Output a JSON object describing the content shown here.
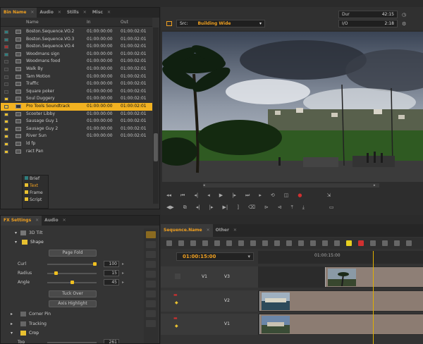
{
  "bin_panel": {
    "tabs": [
      {
        "label": "Bin Name",
        "active": true
      },
      {
        "label": "Audio",
        "active": false
      },
      {
        "label": "Stills",
        "active": false
      },
      {
        "label": "Misc",
        "active": false
      }
    ],
    "columns": [
      "Name",
      "In",
      "Out"
    ],
    "rows": [
      {
        "name": "Boston.Sequence.VO.2",
        "in": "01:00:00:00",
        "out": "01:00:02:01",
        "color": "#2e7e7e",
        "selected": false
      },
      {
        "name": "Boston.Sequence.VO.3",
        "in": "01:00:00:00",
        "out": "01:00:02:01",
        "color": "#2e7e7e",
        "selected": false
      },
      {
        "name": "Boston.Sequence.VO.4",
        "in": "01:00:00:00",
        "out": "01:00:02:01",
        "color": "#a83030",
        "selected": false
      },
      {
        "name": "Woodmans sign",
        "in": "01:00:00:00",
        "out": "01:00:02:01",
        "color": "#2e7e7e",
        "selected": false
      },
      {
        "name": "Woodmans food",
        "in": "01:00:00:00",
        "out": "01:00:02:01",
        "color": "",
        "selected": false
      },
      {
        "name": "Walk By",
        "in": "01:00:00:00",
        "out": "01:00:02:01",
        "color": "",
        "selected": false
      },
      {
        "name": "Tam Motion",
        "in": "01:00:00:00",
        "out": "01:00:02:01",
        "color": "",
        "selected": false
      },
      {
        "name": "Traffic",
        "in": "01:00:00:00",
        "out": "01:00:02:01",
        "color": "",
        "selected": false
      },
      {
        "name": "Square poker",
        "in": "01:00:00:00",
        "out": "01:00:02:01",
        "color": "",
        "selected": false
      },
      {
        "name": "Soul Duggery",
        "in": "01:00:00:00",
        "out": "01:00:02:01",
        "color": "#e8c030",
        "selected": false
      },
      {
        "name": "Pro Tools Soundtrack",
        "in": "01:00:00:00",
        "out": "01:00:02:01",
        "color": "#e8c030",
        "selected": true
      },
      {
        "name": "Scooter Libby",
        "in": "01:00:00:00",
        "out": "01:00:02:01",
        "color": "#e8c030",
        "selected": false
      },
      {
        "name": "Sausage Guy 1",
        "in": "01:00:00:00",
        "out": "01:00:02:01",
        "color": "#e8c030",
        "selected": false
      },
      {
        "name": "Sausage Guy 2",
        "in": "01:00:00:00",
        "out": "01:00:02:01",
        "color": "#e8c030",
        "selected": false
      },
      {
        "name": "River Sun",
        "in": "01:00:00:00",
        "out": "01:00:02:01",
        "color": "#e8c030",
        "selected": false
      },
      {
        "name": "ld fp",
        "in": "",
        "out": "",
        "color": "#e8c030",
        "selected": false
      },
      {
        "name": "ract Pan",
        "in": "",
        "out": "",
        "color": "#e8c030",
        "selected": false
      }
    ],
    "overlay_items": [
      {
        "label": "Brief",
        "color": "#2e7e7e"
      },
      {
        "label": "Text",
        "color": "#e8c030"
      },
      {
        "label": "Frame",
        "color": "#e8c030"
      },
      {
        "label": "Script",
        "color": "#e8c030"
      }
    ]
  },
  "viewer": {
    "src_label": "Src:",
    "clip_name": "Building Wide",
    "dur_label": "Dur",
    "dur_value": "42:15",
    "io_label": "I/O",
    "io_value": "2:18"
  },
  "fx_panel": {
    "tabs": [
      {
        "label": "FX Settings",
        "active": true
      },
      {
        "label": "Audio",
        "active": false
      }
    ],
    "effect_name": "3D Tilt",
    "shape_group": "Shape",
    "page_fold": "Page Fold",
    "params": [
      {
        "label": "Curl",
        "value": "100",
        "level": 1.0
      },
      {
        "label": "Radius",
        "value": "15",
        "level": 0.15
      },
      {
        "label": "Angle",
        "value": "45",
        "level": 0.5
      }
    ],
    "tuck_over": "Tuck Over",
    "axis_highlight": "Axis Highlight",
    "groups": [
      "Corner Pin",
      "Tracking",
      "Crop"
    ],
    "top_label": "Top",
    "top_value": "261"
  },
  "timeline": {
    "tabs": [
      {
        "label": "Sequence.Name",
        "active": true
      },
      {
        "label": "Other",
        "active": false
      }
    ],
    "timecode": "01:00:15:00",
    "ruler_label": "01:00:15:00",
    "tracks": [
      {
        "source": "V1",
        "record": "V3"
      },
      {
        "source": "",
        "record": "V2"
      },
      {
        "source": "",
        "record": "V1"
      }
    ]
  }
}
